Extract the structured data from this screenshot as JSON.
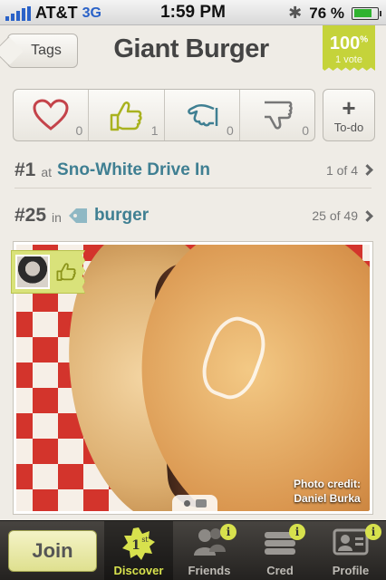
{
  "status_bar": {
    "carrier": "AT&T",
    "network": "3G",
    "time": "1:59 PM",
    "battery": "76 %",
    "battery_level": 0.76
  },
  "header": {
    "back_label": "Tags",
    "title": "Giant Burger",
    "score_value": "100",
    "score_unit": "%",
    "score_votes": "1 vote",
    "score_color": "#c5d33a"
  },
  "ratings": [
    {
      "name": "love",
      "icon": "heart-icon",
      "count": "0"
    },
    {
      "name": "like",
      "icon": "thumbs-up-icon",
      "count": "1"
    },
    {
      "name": "meh",
      "icon": "thumbs-sideways-icon",
      "count": "0"
    },
    {
      "name": "dislike",
      "icon": "thumbs-down-icon",
      "count": "0"
    }
  ],
  "todo": {
    "plus": "+",
    "label": "To-do"
  },
  "ranks": [
    {
      "rank": "#1",
      "prep": "at",
      "name": "Sno-White Drive In",
      "position": "1 of 4"
    },
    {
      "rank": "#25",
      "prep": "in",
      "name": "burger",
      "position": "25 of 49"
    }
  ],
  "photo": {
    "credit_line1": "Photo credit:",
    "credit_line2": "Daniel Burka"
  },
  "tab_bar": {
    "join_label": "Join",
    "tabs": [
      {
        "label": "Discover",
        "icon": "discover-star-icon",
        "badge_text": "1",
        "badge_sup": "st",
        "active": true
      },
      {
        "label": "Friends",
        "icon": "friends-icon",
        "info": "i"
      },
      {
        "label": "Cred",
        "icon": "cred-icon",
        "info": "i"
      },
      {
        "label": "Profile",
        "icon": "profile-card-icon",
        "info": "i"
      }
    ]
  },
  "colors": {
    "accent": "#d7e14d",
    "link": "#3f7f92",
    "heart": "#c4434a",
    "thumb_up": "#a9b21f",
    "thumb_side": "#3f7f92",
    "thumb_down": "#777777"
  }
}
